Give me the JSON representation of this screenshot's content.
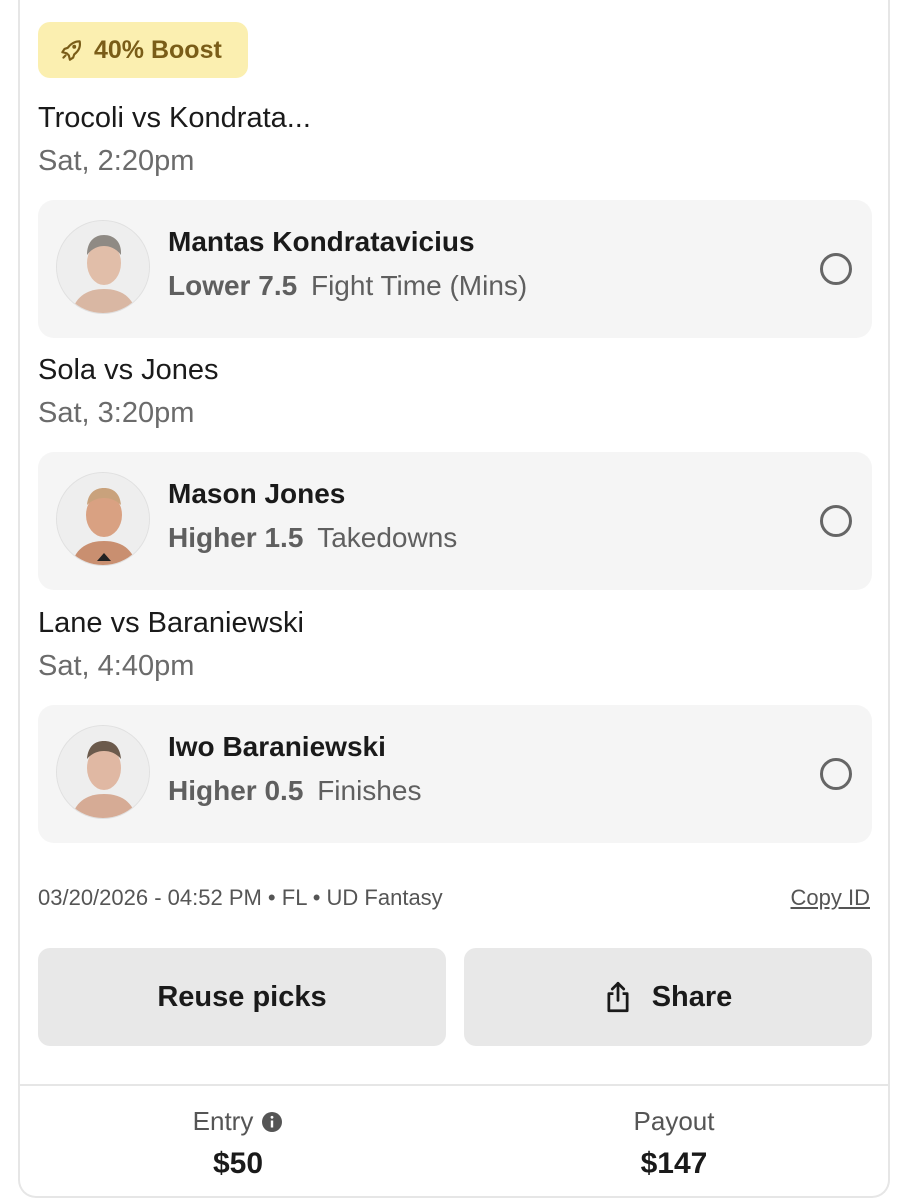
{
  "boost": {
    "label": "40% Boost",
    "icon": "rocket-icon"
  },
  "picks": [
    {
      "matchup": "Trocoli vs Kondrata...",
      "time": "Sat, 2:20pm",
      "player": "Mantas Kondratavicius",
      "direction": "Lower",
      "line": "7.5",
      "stat": "Fight Time (Mins)"
    },
    {
      "matchup": "Sola vs Jones",
      "time": "Sat, 3:20pm",
      "player": "Mason Jones",
      "direction": "Higher",
      "line": "1.5",
      "stat": "Takedowns"
    },
    {
      "matchup": "Lane vs Baraniewski",
      "time": "Sat, 4:40pm",
      "player": "Iwo Baraniewski",
      "direction": "Higher",
      "line": "0.5",
      "stat": "Finishes"
    }
  ],
  "meta": {
    "info": "03/20/2026 - 04:52 PM • FL • UD Fantasy",
    "copy_id": "Copy ID"
  },
  "buttons": {
    "reuse": "Reuse picks",
    "share": "Share"
  },
  "footer": {
    "entry_label": "Entry",
    "entry_value": "$50",
    "payout_label": "Payout",
    "payout_value": "$147"
  },
  "colors": {
    "boost_bg": "#fbefb0",
    "boost_text": "#7a5d18",
    "pick_bg": "#f5f5f5",
    "button_bg": "#e8e8e8"
  }
}
